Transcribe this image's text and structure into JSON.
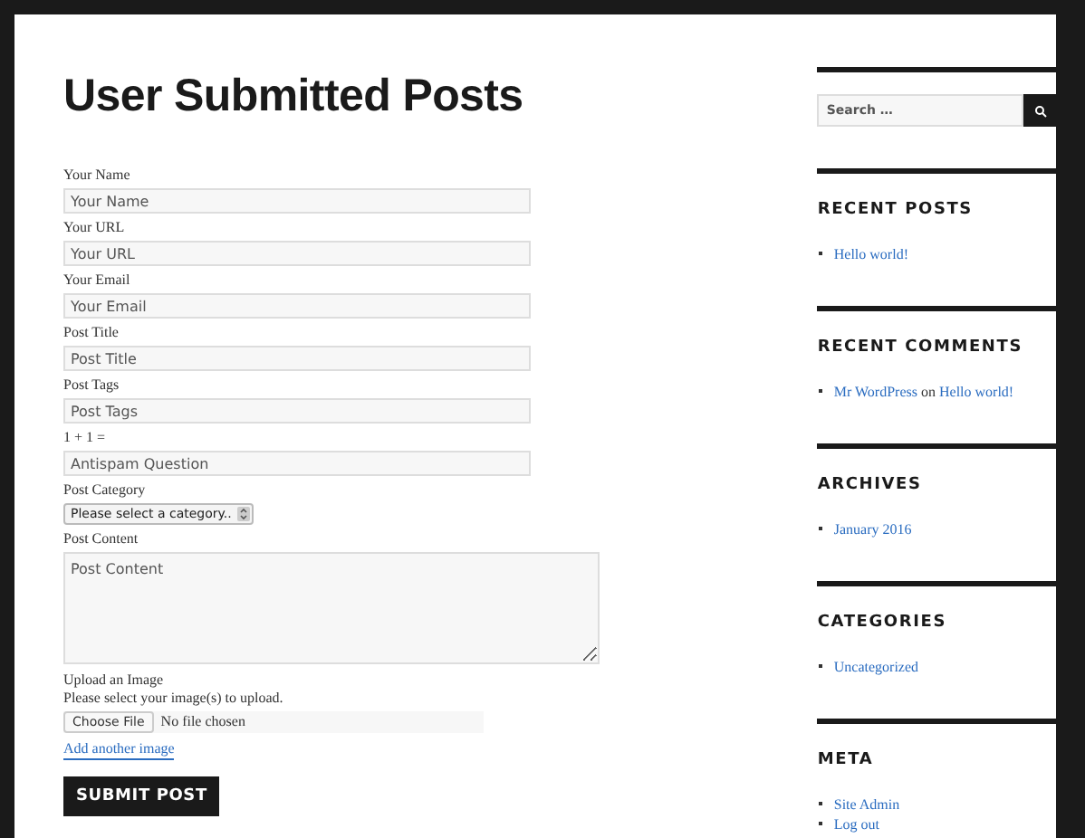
{
  "title": "User Submitted Posts",
  "fields": [
    {
      "kind": "text",
      "label": "Your Name",
      "placeholder": "Your Name"
    },
    {
      "kind": "text",
      "label": "Your URL",
      "placeholder": "Your URL"
    },
    {
      "kind": "text",
      "label": "Your Email",
      "placeholder": "Your Email"
    },
    {
      "kind": "text",
      "label": "Post Title",
      "placeholder": "Post Title"
    },
    {
      "kind": "text",
      "label": "Post Tags",
      "placeholder": "Post Tags"
    },
    {
      "kind": "text",
      "label": "1 + 1 =",
      "placeholder": "Antispam Question"
    },
    {
      "kind": "select",
      "label": "Post Category",
      "value": "Please select a category.."
    },
    {
      "kind": "textarea",
      "label": "Post Content",
      "placeholder": "Post Content"
    }
  ],
  "upload": {
    "label": "Upload an Image",
    "hint": "Please select your image(s) to upload.",
    "button": "Choose File",
    "status": "No file chosen",
    "add_link": "Add another image"
  },
  "submit": "SUBMIT POST",
  "sidebar": {
    "search": {
      "placeholder": "Search …"
    },
    "widgets": [
      {
        "title": "RECENT POSTS",
        "items": [
          [
            {
              "text": "Hello world!",
              "link": true
            }
          ]
        ]
      },
      {
        "title": "RECENT COMMENTS",
        "items": [
          [
            {
              "text": "Mr WordPress",
              "link": true
            },
            {
              "text": "on",
              "link": false
            },
            {
              "text": "Hello world!",
              "link": true
            }
          ]
        ]
      },
      {
        "title": "ARCHIVES",
        "items": [
          [
            {
              "text": "January 2016",
              "link": true
            }
          ]
        ]
      },
      {
        "title": "CATEGORIES",
        "items": [
          [
            {
              "text": "Uncategorized",
              "link": true
            }
          ]
        ]
      },
      {
        "title": "META",
        "items": [
          [
            {
              "text": "Site Admin",
              "link": true
            }
          ],
          [
            {
              "text": "Log out",
              "link": true
            }
          ]
        ]
      }
    ]
  }
}
